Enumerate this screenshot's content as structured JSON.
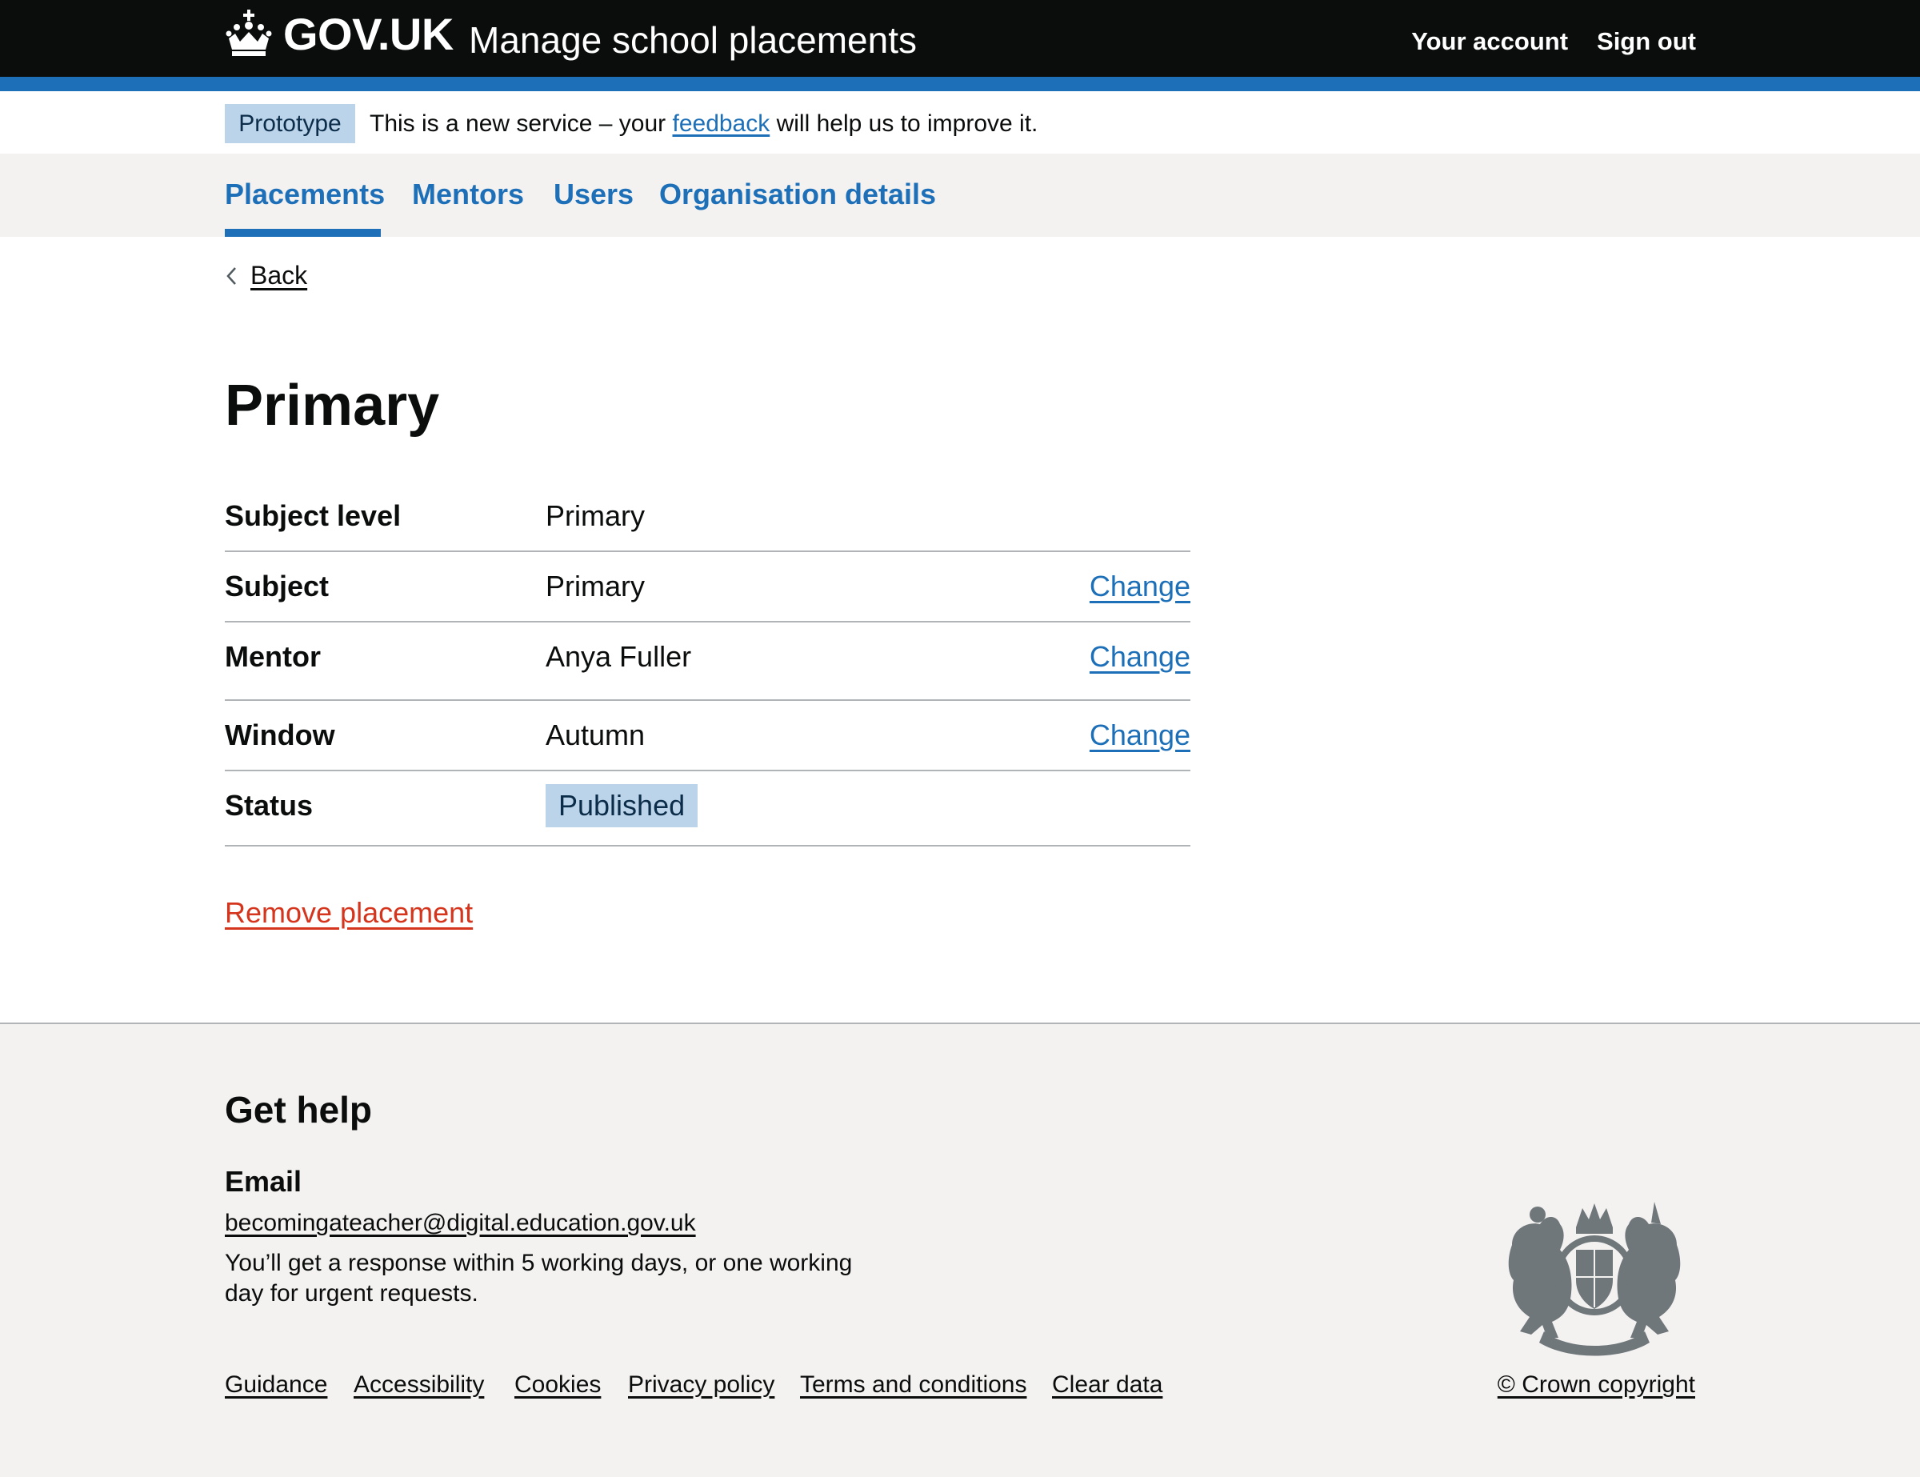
{
  "header": {
    "logo_text": "GOV.UK",
    "service_name": "Manage school placements",
    "nav": [
      {
        "label": "Your account"
      },
      {
        "label": "Sign out"
      }
    ]
  },
  "phase_banner": {
    "tag": "Prototype",
    "text_before": "This is a new service – your ",
    "link": "feedback",
    "text_after": " will help us to improve it."
  },
  "primary_nav": {
    "items": [
      {
        "label": "Placements",
        "active": true
      },
      {
        "label": "Mentors",
        "active": false
      },
      {
        "label": "Users",
        "active": false
      },
      {
        "label": "Organisation details",
        "active": false
      }
    ]
  },
  "back_link": "Back",
  "page_title": "Primary",
  "summary": {
    "rows": [
      {
        "key": "Subject level",
        "value": "Primary",
        "action": ""
      },
      {
        "key": "Subject",
        "value": "Primary",
        "action": "Change"
      },
      {
        "key": "Mentor",
        "value": "Anya Fuller",
        "action": "Change"
      },
      {
        "key": "Window",
        "value": "Autumn",
        "action": "Change"
      },
      {
        "key": "Status",
        "value": "Published",
        "action": ""
      }
    ]
  },
  "remove_link": "Remove placement",
  "footer": {
    "help_title": "Get help",
    "email_label": "Email",
    "email": "becomingateacher@digital.education.gov.uk",
    "response_text": "You’ll get a response within 5 working days, or one working day for urgent requests.",
    "links": [
      {
        "label": "Guidance"
      },
      {
        "label": "Accessibility"
      },
      {
        "label": "Cookies"
      },
      {
        "label": "Privacy policy"
      },
      {
        "label": "Terms and conditions"
      },
      {
        "label": "Clear data"
      }
    ],
    "copyright": "© Crown copyright"
  },
  "colors": {
    "header_bg": "#0b0c0c",
    "brand_blue": "#1d70b8",
    "link_blue": "#1d70b8",
    "tag_bg": "#bbd4ea",
    "tag_text": "#0c2d4a",
    "danger_red": "#d4351c",
    "footer_bg": "#f3f2f1",
    "border_grey": "#b1b4b6"
  },
  "icons": {
    "logo": "crown-icon",
    "back": "chevron-left-icon",
    "footer": "royal-coat-of-arms-icon"
  }
}
